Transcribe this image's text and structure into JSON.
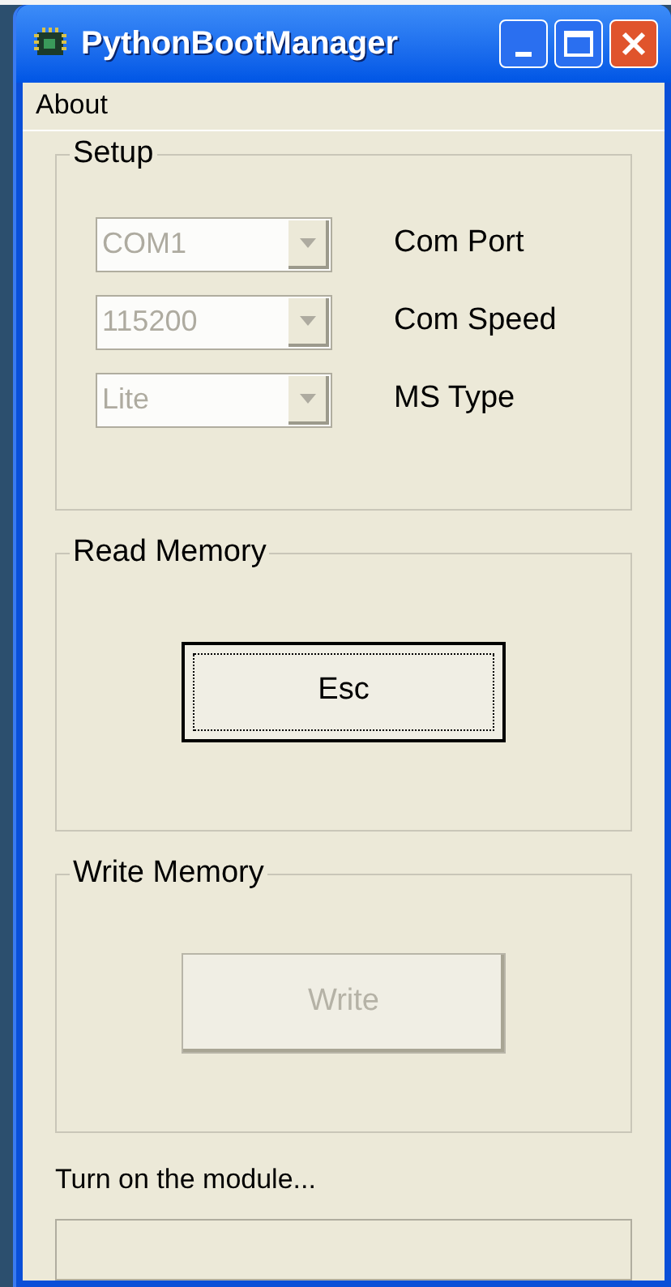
{
  "window": {
    "title": "PythonBootManager"
  },
  "menu": [
    {
      "label": "About"
    }
  ],
  "setup": {
    "title": "Setup",
    "fields": [
      {
        "value": "COM1",
        "label": "Com Port",
        "disabled": true
      },
      {
        "value": "115200",
        "label": "Com Speed",
        "disabled": true
      },
      {
        "value": "Lite",
        "label": "MS Type",
        "disabled": true
      }
    ]
  },
  "read_memory": {
    "title": "Read Memory",
    "button": {
      "label": "Esc",
      "disabled": false,
      "focused": true
    }
  },
  "write_memory": {
    "title": "Write Memory",
    "button": {
      "label": "Write",
      "disabled": true,
      "focused": false
    }
  },
  "status_text": "Turn on the module...",
  "progress": {
    "level": 0
  }
}
